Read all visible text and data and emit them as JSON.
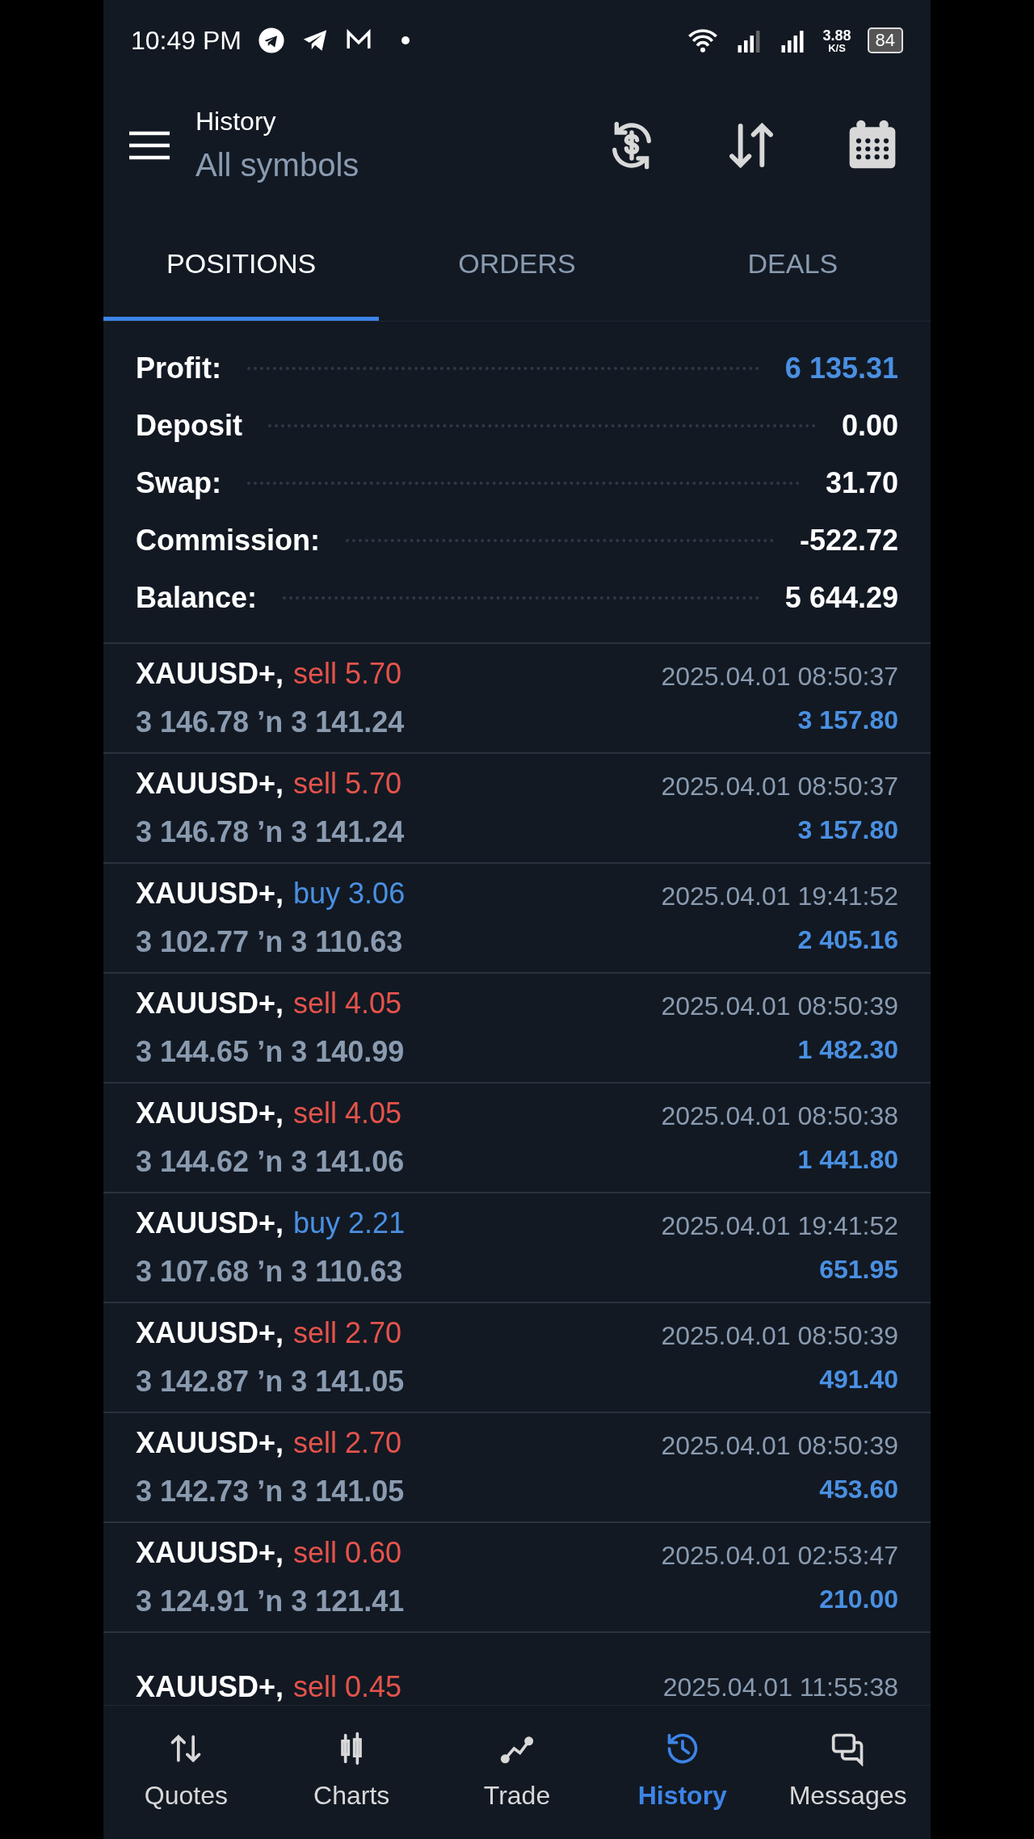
{
  "status_bar": {
    "time": "10:49 PM",
    "speed": "3.88",
    "speed_unit": "K/S",
    "battery": "84"
  },
  "header": {
    "title": "History",
    "subtitle": "All symbols"
  },
  "tabs": [
    {
      "label": "POSITIONS",
      "selected": true
    },
    {
      "label": "ORDERS",
      "selected": false
    },
    {
      "label": "DEALS",
      "selected": false
    }
  ],
  "summary": [
    {
      "label": "Profit:",
      "value": "6 135.31",
      "kind": "highlight"
    },
    {
      "label": "Deposit",
      "value": "0.00",
      "kind": "plain"
    },
    {
      "label": "Swap:",
      "value": "31.70",
      "kind": "plain"
    },
    {
      "label": "Commission:",
      "value": "-522.72",
      "kind": "plain"
    },
    {
      "label": "Balance:",
      "value": "5 644.29",
      "kind": "plain"
    }
  ],
  "positions": [
    {
      "symbol": "XAUUSD+,",
      "kind": "sell",
      "volume": "sell 5.70",
      "prices": "3 146.78 ʼn 3 141.24",
      "time": "2025.04.01 08:50:37",
      "profit": "3 157.80"
    },
    {
      "symbol": "XAUUSD+,",
      "kind": "sell",
      "volume": "sell 5.70",
      "prices": "3 146.78 ʼn 3 141.24",
      "time": "2025.04.01 08:50:37",
      "profit": "3 157.80"
    },
    {
      "symbol": "XAUUSD+,",
      "kind": "buy",
      "volume": "buy 3.06",
      "prices": "3 102.77 ʼn 3 110.63",
      "time": "2025.04.01 19:41:52",
      "profit": "2 405.16"
    },
    {
      "symbol": "XAUUSD+,",
      "kind": "sell",
      "volume": "sell 4.05",
      "prices": "3 144.65 ʼn 3 140.99",
      "time": "2025.04.01 08:50:39",
      "profit": "1 482.30"
    },
    {
      "symbol": "XAUUSD+,",
      "kind": "sell",
      "volume": "sell 4.05",
      "prices": "3 144.62 ʼn 3 141.06",
      "time": "2025.04.01 08:50:38",
      "profit": "1 441.80"
    },
    {
      "symbol": "XAUUSD+,",
      "kind": "buy",
      "volume": "buy 2.21",
      "prices": "3 107.68 ʼn 3 110.63",
      "time": "2025.04.01 19:41:52",
      "profit": "651.95"
    },
    {
      "symbol": "XAUUSD+,",
      "kind": "sell",
      "volume": "sell 2.70",
      "prices": "3 142.87 ʼn 3 141.05",
      "time": "2025.04.01 08:50:39",
      "profit": "491.40"
    },
    {
      "symbol": "XAUUSD+,",
      "kind": "sell",
      "volume": "sell 2.70",
      "prices": "3 142.73 ʼn 3 141.05",
      "time": "2025.04.01 08:50:39",
      "profit": "453.60"
    },
    {
      "symbol": "XAUUSD+,",
      "kind": "sell",
      "volume": "sell 0.60",
      "prices": "3 124.91 ʼn 3 121.41",
      "time": "2025.04.01 02:53:47",
      "profit": "210.00"
    },
    {
      "symbol": "XAUUSD+,",
      "kind": "sell",
      "volume": "sell 0.45",
      "time": "2025.04.01 11:55:38"
    }
  ],
  "bottom_nav": [
    {
      "label": "Quotes",
      "kind": "quotes",
      "selected": false
    },
    {
      "label": "Charts",
      "kind": "charts",
      "selected": false
    },
    {
      "label": "Trade",
      "kind": "trade",
      "selected": false
    },
    {
      "label": "History",
      "kind": "history",
      "selected": true
    },
    {
      "label": "Messages",
      "kind": "messages",
      "selected": false
    }
  ]
}
